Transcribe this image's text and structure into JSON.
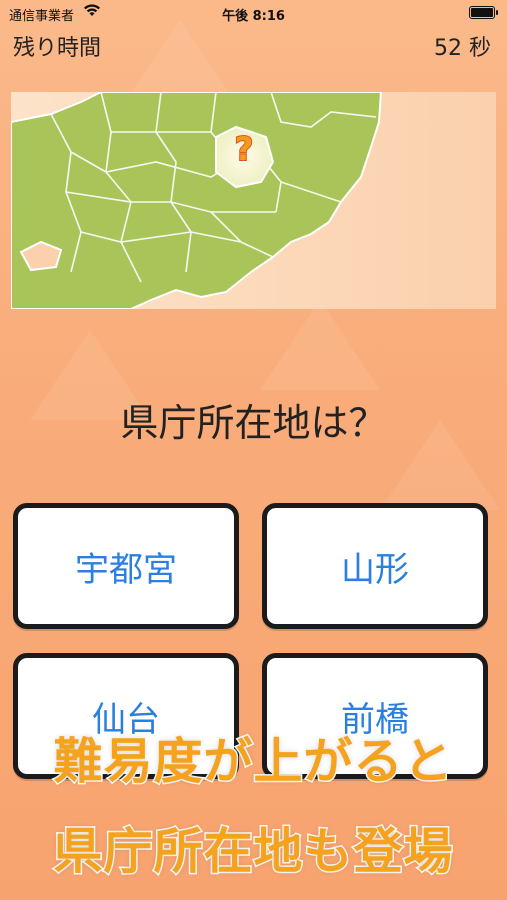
{
  "status": {
    "carrier": "通信事業者",
    "time": "午後 8:16"
  },
  "header": {
    "timer_label": "残り時間",
    "timer_value": "52 秒"
  },
  "map": {
    "marker": "?"
  },
  "question": "県庁所在地は？",
  "choices": [
    {
      "label": "宇都宮"
    },
    {
      "label": "山形"
    },
    {
      "label": "仙台"
    },
    {
      "label": "前橋"
    }
  ],
  "banner": {
    "line1": "難易度が上がると",
    "line2": "県庁所在地も登場"
  },
  "colors": {
    "background": "#f9ad7b",
    "choice_text": "#2b7fe0",
    "banner_text": "#f5a21f",
    "map_land": "#a9c55a"
  }
}
